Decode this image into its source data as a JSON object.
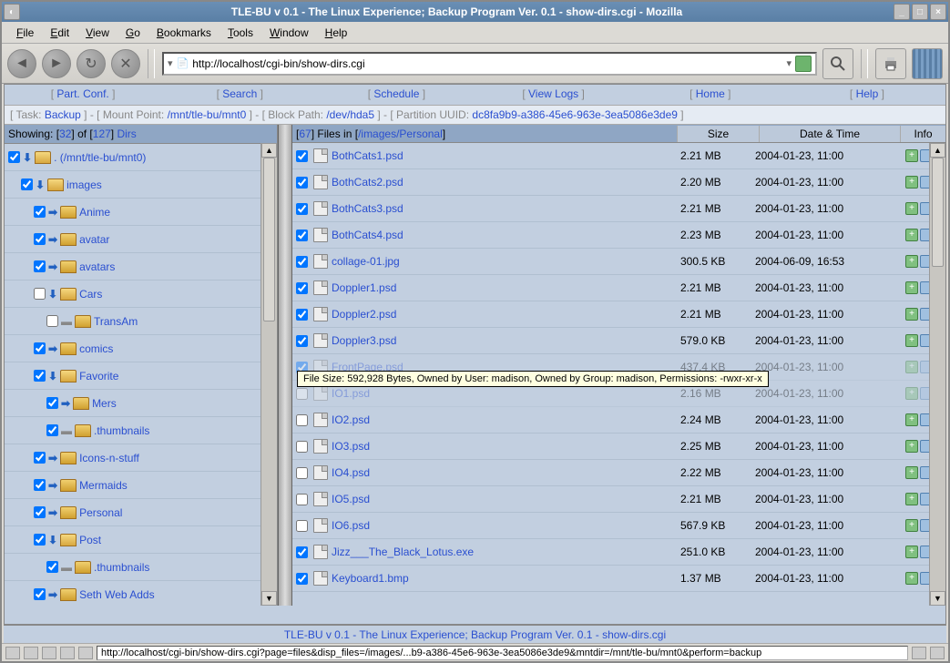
{
  "window_title": "TLE-BU v 0.1 - The Linux Experience; Backup Program Ver. 0.1 - show-dirs.cgi - Mozilla",
  "menubar": [
    "File",
    "Edit",
    "View",
    "Go",
    "Bookmarks",
    "Tools",
    "Window",
    "Help"
  ],
  "url": "http://localhost/cgi-bin/show-dirs.cgi",
  "navtabs": [
    {
      "label": "Part. Conf."
    },
    {
      "label": "Search"
    },
    {
      "label": "Schedule"
    },
    {
      "label": "View Logs"
    },
    {
      "label": "Home"
    },
    {
      "label": "Help"
    }
  ],
  "infobar": {
    "task_label": "Task:",
    "task_value": "Backup",
    "mount_label": "Mount Point:",
    "mount_value": "/mnt/tle-bu/mnt0",
    "block_label": "Block Path:",
    "block_value": "/dev/hda5",
    "uuid_label": "Partition UUID:",
    "uuid_value": "dc8fa9b9-a386-45e6-963e-3ea5086e3de9"
  },
  "left": {
    "showing_pre": "Showing:",
    "showing_a": "32",
    "showing_mid": "of",
    "showing_b": "127",
    "showing_post": "Dirs",
    "tree": [
      {
        "indent": 0,
        "checked": true,
        "arrow": "down",
        "open": true,
        "label": ". (/mnt/tle-bu/mnt0)"
      },
      {
        "indent": 1,
        "checked": true,
        "arrow": "down",
        "open": true,
        "label": "images"
      },
      {
        "indent": 2,
        "checked": true,
        "arrow": "right",
        "open": false,
        "label": "Anime"
      },
      {
        "indent": 2,
        "checked": true,
        "arrow": "right",
        "open": false,
        "label": "avatar"
      },
      {
        "indent": 2,
        "checked": true,
        "arrow": "right",
        "open": false,
        "label": "avatars"
      },
      {
        "indent": 2,
        "checked": false,
        "arrow": "down",
        "open": true,
        "label": "Cars"
      },
      {
        "indent": 3,
        "checked": false,
        "arrow": "gray",
        "open": false,
        "label": "TransAm"
      },
      {
        "indent": 2,
        "checked": true,
        "arrow": "right",
        "open": false,
        "label": "comics"
      },
      {
        "indent": 2,
        "checked": true,
        "arrow": "down",
        "open": true,
        "label": "Favorite"
      },
      {
        "indent": 3,
        "checked": true,
        "arrow": "right",
        "open": false,
        "label": "Mers"
      },
      {
        "indent": 3,
        "checked": true,
        "arrow": "gray",
        "open": false,
        "label": ".thumbnails"
      },
      {
        "indent": 2,
        "checked": true,
        "arrow": "right",
        "open": false,
        "label": "Icons-n-stuff"
      },
      {
        "indent": 2,
        "checked": true,
        "arrow": "right",
        "open": false,
        "label": "Mermaids"
      },
      {
        "indent": 2,
        "checked": true,
        "arrow": "right",
        "open": false,
        "label": "Personal"
      },
      {
        "indent": 2,
        "checked": true,
        "arrow": "down",
        "open": true,
        "label": "Post"
      },
      {
        "indent": 3,
        "checked": true,
        "arrow": "gray",
        "open": false,
        "label": ".thumbnails"
      },
      {
        "indent": 2,
        "checked": true,
        "arrow": "right",
        "open": false,
        "label": "Seth Web Adds"
      }
    ]
  },
  "right": {
    "count": "67",
    "count_mid": "Files in",
    "path": "/images/Personal",
    "col_size": "Size",
    "col_dt": "Date & Time",
    "col_info": "Info",
    "files": [
      {
        "checked": true,
        "name": "BothCats1.psd",
        "size": "2.21 MB",
        "dt": "2004-01-23, 11:00"
      },
      {
        "checked": true,
        "name": "BothCats2.psd",
        "size": "2.20 MB",
        "dt": "2004-01-23, 11:00"
      },
      {
        "checked": true,
        "name": "BothCats3.psd",
        "size": "2.21 MB",
        "dt": "2004-01-23, 11:00"
      },
      {
        "checked": true,
        "name": "BothCats4.psd",
        "size": "2.23 MB",
        "dt": "2004-01-23, 11:00"
      },
      {
        "checked": true,
        "name": "collage-01.jpg",
        "size": "300.5 KB",
        "dt": "2004-06-09, 16:53"
      },
      {
        "checked": true,
        "name": "Doppler1.psd",
        "size": "2.21 MB",
        "dt": "2004-01-23, 11:00"
      },
      {
        "checked": true,
        "name": "Doppler2.psd",
        "size": "2.21 MB",
        "dt": "2004-01-23, 11:00"
      },
      {
        "checked": true,
        "name": "Doppler3.psd",
        "size": "579.0 KB",
        "dt": "2004-01-23, 11:00"
      },
      {
        "checked": true,
        "name": "FrontPage.psd",
        "size": "437.4 KB",
        "dt": "2004-01-23, 11:00",
        "obscured": true
      },
      {
        "checked": false,
        "name": "IO1.psd",
        "size": "2.16 MB",
        "dt": "2004-01-23, 11:00",
        "obscured": true
      },
      {
        "checked": false,
        "name": "IO2.psd",
        "size": "2.24 MB",
        "dt": "2004-01-23, 11:00"
      },
      {
        "checked": false,
        "name": "IO3.psd",
        "size": "2.25 MB",
        "dt": "2004-01-23, 11:00"
      },
      {
        "checked": false,
        "name": "IO4.psd",
        "size": "2.22 MB",
        "dt": "2004-01-23, 11:00"
      },
      {
        "checked": false,
        "name": "IO5.psd",
        "size": "2.21 MB",
        "dt": "2004-01-23, 11:00"
      },
      {
        "checked": false,
        "name": "IO6.psd",
        "size": "567.9 KB",
        "dt": "2004-01-23, 11:00"
      },
      {
        "checked": true,
        "name": "Jizz___The_Black_Lotus.exe",
        "size": "251.0 KB",
        "dt": "2004-01-23, 11:00"
      },
      {
        "checked": true,
        "name": "Keyboard1.bmp",
        "size": "1.37 MB",
        "dt": "2004-01-23, 11:00"
      }
    ]
  },
  "tooltip": "File Size: 592,928 Bytes, Owned by User: madison, Owned by Group: madison, Permissions: -rwxr-xr-x",
  "footer": "TLE-BU v 0.1 - The Linux Experience; Backup Program Ver. 0.1 - show-dirs.cgi",
  "status": "http://localhost/cgi-bin/show-dirs.cgi?page=files&disp_files=/images/...b9-a386-45e6-963e-3ea5086e3de9&mntdir=/mnt/tle-bu/mnt0&perform=backup"
}
